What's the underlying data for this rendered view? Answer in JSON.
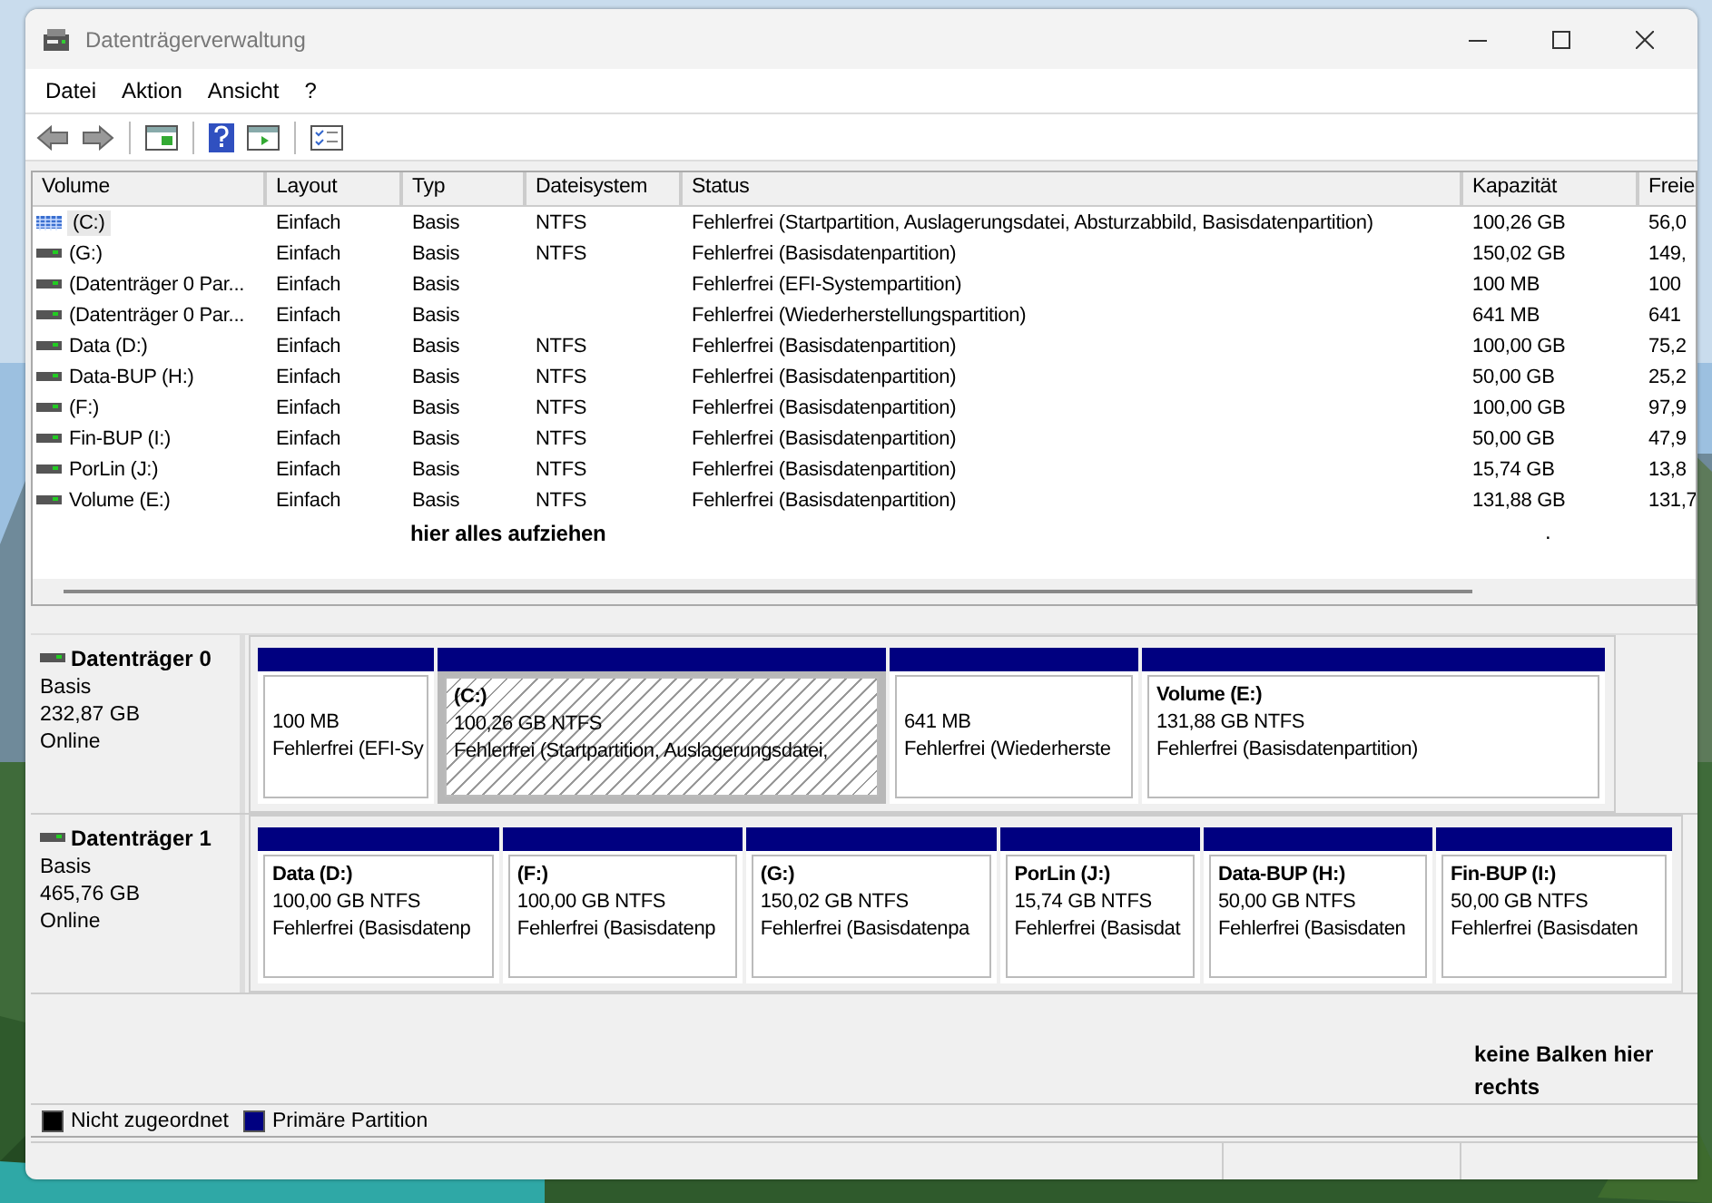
{
  "window": {
    "title": "Datenträgerverwaltung"
  },
  "menu": [
    "Datei",
    "Aktion",
    "Ansicht",
    "?"
  ],
  "volume_list": {
    "columns": [
      "Volume",
      "Layout",
      "Typ",
      "Dateisystem",
      "Status",
      "Kapazität",
      "Freie"
    ],
    "rows": [
      {
        "selected": true,
        "cells": [
          "(C:)",
          "Einfach",
          "Basis",
          "NTFS",
          "Fehlerfrei (Startpartition, Auslagerungsdatei, Absturzabbild, Basisdatenpartition)",
          "100,26 GB",
          "56,0"
        ]
      },
      {
        "selected": false,
        "cells": [
          "(G:)",
          "Einfach",
          "Basis",
          "NTFS",
          "Fehlerfrei (Basisdatenpartition)",
          "150,02 GB",
          "149,"
        ]
      },
      {
        "selected": false,
        "cells": [
          "(Datenträger 0 Par...",
          "Einfach",
          "Basis",
          "",
          "Fehlerfrei (EFI-Systempartition)",
          "100 MB",
          "100"
        ]
      },
      {
        "selected": false,
        "cells": [
          "(Datenträger 0 Par...",
          "Einfach",
          "Basis",
          "",
          "Fehlerfrei (Wiederherstellungspartition)",
          "641 MB",
          "641"
        ]
      },
      {
        "selected": false,
        "cells": [
          "Data (D:)",
          "Einfach",
          "Basis",
          "NTFS",
          "Fehlerfrei (Basisdatenpartition)",
          "100,00 GB",
          "75,2"
        ]
      },
      {
        "selected": false,
        "cells": [
          "Data-BUP (H:)",
          "Einfach",
          "Basis",
          "NTFS",
          "Fehlerfrei (Basisdatenpartition)",
          "50,00 GB",
          "25,2"
        ]
      },
      {
        "selected": false,
        "cells": [
          "(F:)",
          "Einfach",
          "Basis",
          "NTFS",
          "Fehlerfrei (Basisdatenpartition)",
          "100,00 GB",
          "97,9"
        ]
      },
      {
        "selected": false,
        "cells": [
          "Fin-BUP (I:)",
          "Einfach",
          "Basis",
          "NTFS",
          "Fehlerfrei (Basisdatenpartition)",
          "50,00 GB",
          "47,9"
        ]
      },
      {
        "selected": false,
        "cells": [
          "PorLin (J:)",
          "Einfach",
          "Basis",
          "NTFS",
          "Fehlerfrei (Basisdatenpartition)",
          "15,74 GB",
          "13,8"
        ]
      },
      {
        "selected": false,
        "cells": [
          "Volume (E:)",
          "Einfach",
          "Basis",
          "NTFS",
          "Fehlerfrei (Basisdatenpartition)",
          "131,88 GB",
          "131,7"
        ]
      }
    ],
    "note": "hier alles aufziehen",
    "mark": "."
  },
  "disks": [
    {
      "name": "Datenträger 0",
      "type": "Basis",
      "size": "232,87 GB",
      "status": "Online",
      "partitions": [
        {
          "size": "100 MB",
          "status": "Fehlerfrei (EFI-Sy",
          "selected": false
        },
        {
          "name": "(C:)",
          "size": "100,26 GB NTFS",
          "status": "Fehlerfrei (Startpartition, Auslagerungsdatei,",
          "selected": true
        },
        {
          "size": "641 MB",
          "status": "Fehlerfrei (Wiederherste",
          "selected": false
        },
        {
          "name": "Volume  (E:)",
          "size": "131,88 GB NTFS",
          "status": "Fehlerfrei (Basisdatenpartition)",
          "selected": false
        }
      ]
    },
    {
      "name": "Datenträger 1",
      "type": "Basis",
      "size": "465,76 GB",
      "status": "Online",
      "partitions": [
        {
          "name": "Data  (D:)",
          "size": "100,00 GB NTFS",
          "status": "Fehlerfrei (Basisdatenp",
          "selected": false
        },
        {
          "name": "(F:)",
          "size": "100,00 GB NTFS",
          "status": "Fehlerfrei (Basisdatenp",
          "selected": false
        },
        {
          "name": "(G:)",
          "size": "150,02 GB NTFS",
          "status": "Fehlerfrei (Basisdatenpa",
          "selected": false
        },
        {
          "name": "PorLin  (J:)",
          "size": "15,74 GB NTFS",
          "status": "Fehlerfrei (Basisdat",
          "selected": false
        },
        {
          "name": "Data-BUP  (H:)",
          "size": "50,00 GB NTFS",
          "status": "Fehlerfrei (Basisdaten",
          "selected": false
        },
        {
          "name": "Fin-BUP  (I:)",
          "size": "50,00 GB NTFS",
          "status": "Fehlerfrei (Basisdaten",
          "selected": false
        }
      ]
    }
  ],
  "map_note": "keine Balken hier rechts",
  "legend": [
    {
      "label": "Nicht zugeordnet",
      "color": "#000000"
    },
    {
      "label": "Primäre Partition",
      "color": "#000080"
    }
  ]
}
